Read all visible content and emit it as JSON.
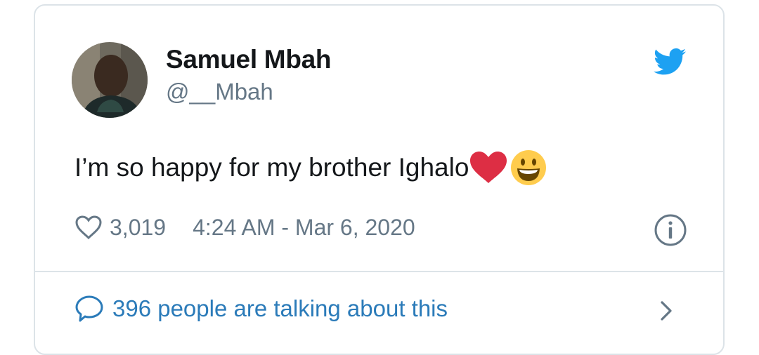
{
  "user": {
    "display_name": "Samuel Mbah",
    "handle": "@__Mbah"
  },
  "tweet": {
    "text": "I’m so happy for my brother Ighalo",
    "emojis": [
      "red-heart-emoji",
      "smiley-emoji"
    ]
  },
  "meta": {
    "likes": "3,019",
    "timestamp": "4:24 AM - Mar 6, 2020"
  },
  "footer": {
    "talking_label": "396 people are talking about this"
  },
  "colors": {
    "text": "#14171a",
    "secondary": "#657786",
    "link": "#2b7bb9",
    "twitter_blue": "#1da1f2",
    "border": "#dce3e8"
  }
}
